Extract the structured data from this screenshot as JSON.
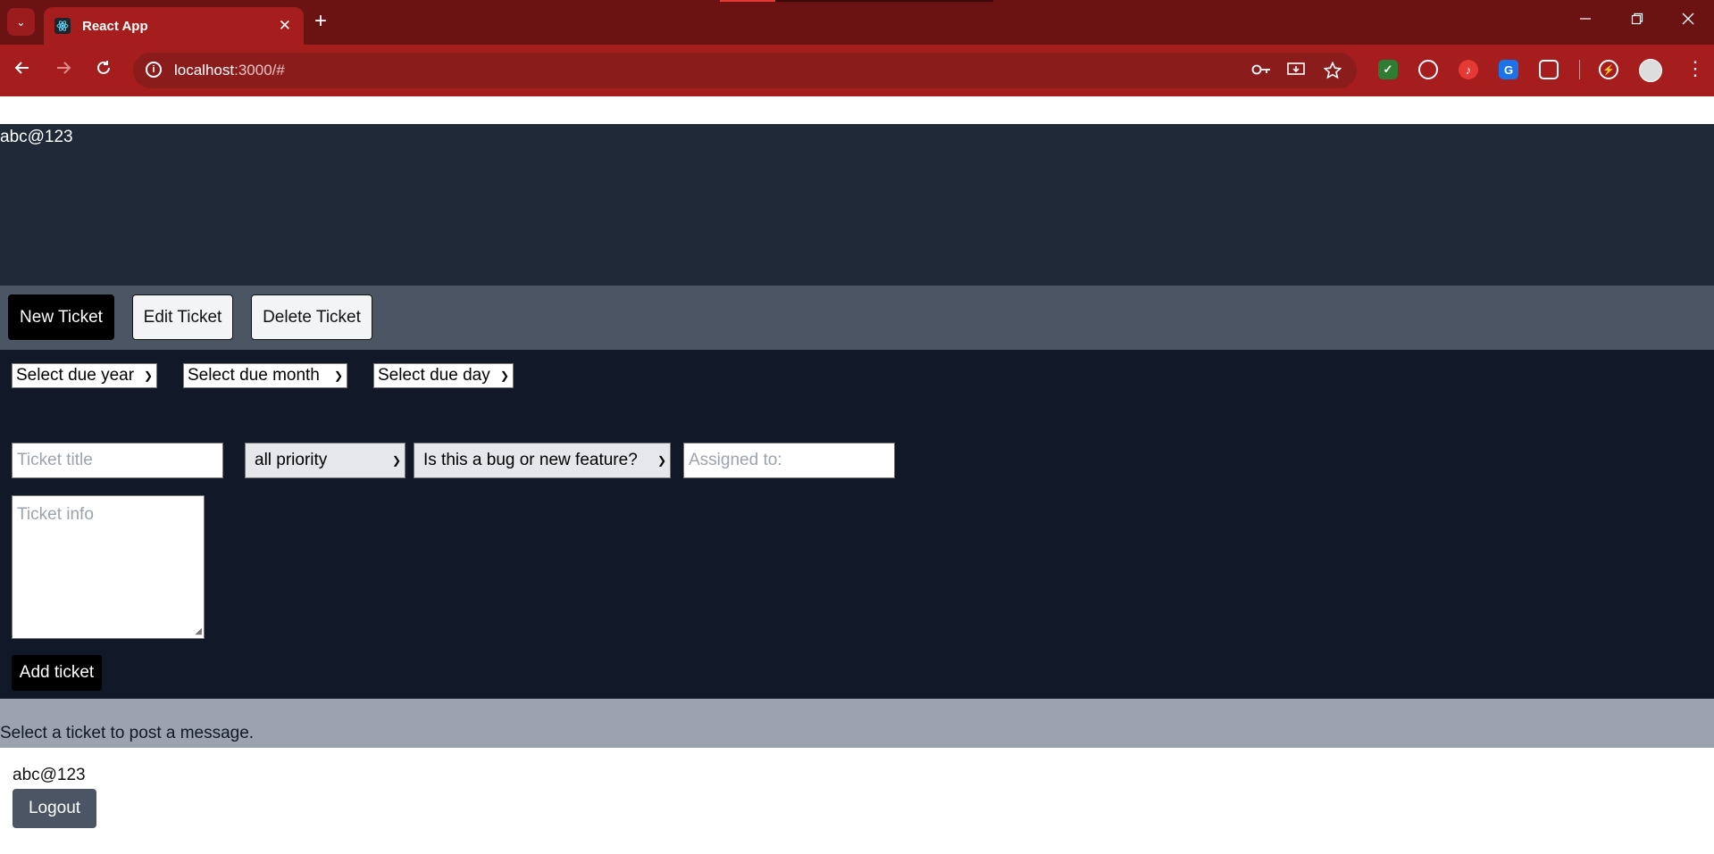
{
  "browser": {
    "tab_title": "React App",
    "url_host": "localhost",
    "url_rest": ":3000/#",
    "new_tab_glyph": "+",
    "close_glyph": "✕",
    "tab_menu_glyph": "⌄",
    "icons": [
      "react-favicon",
      "back-icon",
      "forward-icon",
      "reload-icon",
      "site-info-icon",
      "password-key-icon",
      "install-app-icon",
      "bookmark-star-icon",
      "shield-extension-icon",
      "speed-extension-icon",
      "music-extension-icon",
      "translate-extension-icon",
      "puzzle-extensions-icon",
      "performance-icon",
      "profile-avatar",
      "more-menu-icon"
    ]
  },
  "header": {
    "username": "abc@123"
  },
  "actions": {
    "new_ticket": "New Ticket",
    "edit_ticket": "Edit Ticket",
    "delete_ticket": "Delete Ticket"
  },
  "form": {
    "due_year": "Select due year",
    "due_month": "Select due month",
    "due_day": "Select due day",
    "ticket_title_placeholder": "Ticket title",
    "priority_value": "all priority",
    "type_value": "Is this a bug or new feature?",
    "assigned_placeholder": "Assigned to:",
    "ticket_info_placeholder": "Ticket info",
    "add_ticket": "Add ticket"
  },
  "messages": {
    "prompt": "Select a ticket to post a message."
  },
  "footer": {
    "username": "abc@123",
    "logout": "Logout"
  },
  "colors": {
    "titlebar": "#6b1313",
    "toolbar": "#a51d1d",
    "header_band": "#1f2937",
    "button_row": "#4b5563",
    "form_area": "#111827",
    "message_band": "#9ca3af"
  }
}
